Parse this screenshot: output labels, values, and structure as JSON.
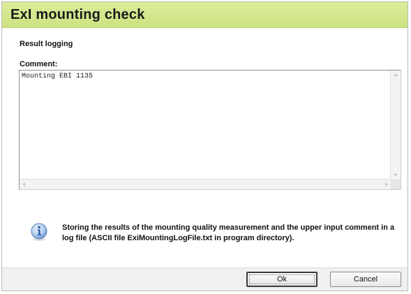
{
  "dialog": {
    "title": "ExI mounting check",
    "section_label": "Result logging",
    "comment_label": "Comment:",
    "comment_value": "Mounting EBI 1135",
    "info_text": "Storing the results of the mounting quality measurement and the upper input comment in a log file (ASCII file ExiMountingLogFile.txt in program directory).",
    "info_icon": "info-icon"
  },
  "buttons": {
    "ok_label": "Ok",
    "cancel_label": "Cancel"
  },
  "colors": {
    "title_bar": "#d4e78c",
    "button_bar": "#f0f0f0",
    "info_icon_blue": "#3b6fb8"
  }
}
